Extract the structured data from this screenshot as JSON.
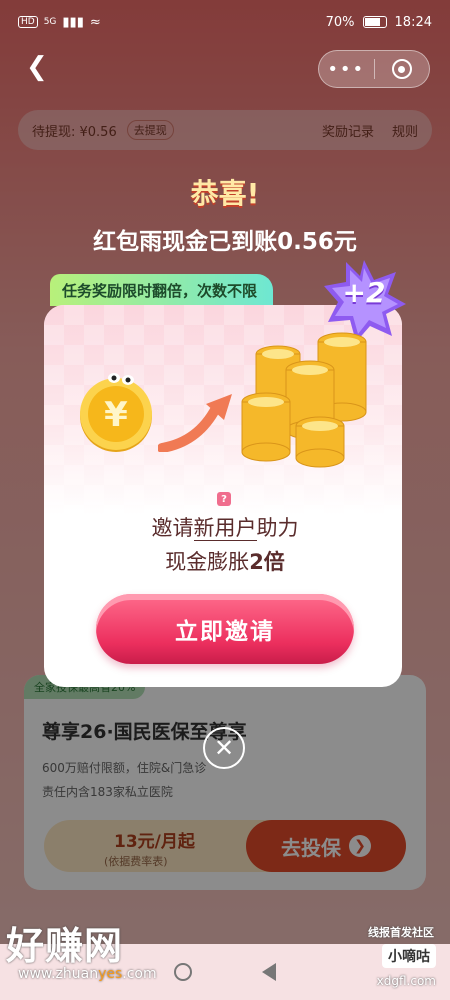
{
  "status_bar": {
    "net_badge": "HD",
    "signal": "5G",
    "battery": "70%",
    "time": "18:24"
  },
  "background_page": {
    "pending_label": "待提现: ¥0.56",
    "withdraw_label": "去提现",
    "records_label": "奖励记录",
    "rules_label": "规则",
    "card_tag": "全家投保最高省20%",
    "card_title": "尊享26·国民医保至尊享",
    "card_line1": "600万赔付限额，住院&门急诊",
    "card_line2": "责任内含183家私立医院",
    "price_label": "13元/月起",
    "price_sub": "(依据费率表)",
    "buy_label": "去投保"
  },
  "popup": {
    "congrats": "恭喜!",
    "amount_line": "红包雨现金已到账0.56元",
    "ribbon": "任务奖励限时翻倍，次数不限",
    "badge": "+2",
    "invite_pre": "邀请",
    "invite_highlight": "新用户",
    "invite_post": "助力",
    "multiplier_pre": "现金膨胀",
    "multiplier_value": "2倍",
    "cta": "立即邀请",
    "question_mark": "?"
  },
  "watermark": {
    "brand": "好赚网",
    "url_pre": "www.zhuan",
    "url_hl": "yes",
    "url_post": ".com",
    "right_top": "线报首发社区",
    "right_mid": "小嘀咕",
    "right_bottom": "xdgfl.com"
  },
  "colors": {
    "cta": "#ec2f5e",
    "congrats": "#ffe9a6",
    "ribbon_start": "#b8f07a"
  }
}
